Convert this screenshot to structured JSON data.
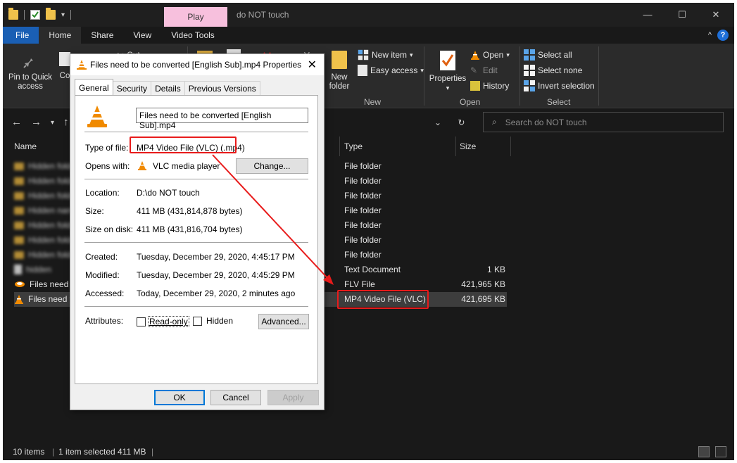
{
  "explorer": {
    "play_tab": "Play",
    "window_title": "do NOT touch",
    "window_controls": [
      "—",
      "☐",
      "✕"
    ],
    "tabs": [
      "File",
      "Home",
      "Share",
      "View",
      "Video Tools"
    ],
    "ribbon": {
      "pin": "Pin to Quick access",
      "copy_trunc": "Co",
      "cut_trunc": "Cut",
      "new_folder": "New folder",
      "new_item": "New item",
      "easy_access": "Easy access",
      "properties": "Properties",
      "open": "Open",
      "edit": "Edit",
      "history": "History",
      "select_all": "Select all",
      "select_none": "Select none",
      "invert_selection": "Invert selection",
      "group_new": "New",
      "group_open": "Open",
      "group_select": "Select"
    },
    "search_placeholder": "Search do NOT touch",
    "columns": {
      "name": "Name",
      "type": "Type",
      "size": "Size"
    },
    "rows": [
      {
        "name": "Hidden folder name",
        "type": "File folder",
        "size": ""
      },
      {
        "name": "Hidden folder name",
        "type": "File folder",
        "size": ""
      },
      {
        "name": "Hidden folder name",
        "type": "File folder",
        "size": ""
      },
      {
        "name": "Hidden name",
        "type": "File folder",
        "size": ""
      },
      {
        "name": "Hidden folder name",
        "type": "File folder",
        "size": ""
      },
      {
        "name": "Hidden folder name",
        "type": "File folder",
        "size": ""
      },
      {
        "name": "Hidden folder name",
        "type": "File folder",
        "size": ""
      },
      {
        "name": "hidden",
        "type": "Text Document",
        "size": "1 KB"
      },
      {
        "name": "Files need t",
        "type": "FLV File",
        "size": "421,965 KB"
      },
      {
        "name": "Files need t",
        "type": "MP4 Video File (VLC)",
        "size": "421,695 KB"
      }
    ],
    "status": {
      "items": "10 items",
      "selected": "1 item selected",
      "size": "411 MB"
    }
  },
  "dialog": {
    "title": "Files need to be converted [English Sub].mp4 Properties",
    "tabs": [
      "General",
      "Security",
      "Details",
      "Previous Versions"
    ],
    "filename": "Files need to be converted [English Sub].mp4",
    "type_label": "Type of file:",
    "type_value": "MP4 Video File (VLC) (.mp4)",
    "opens_label": "Opens with:",
    "opens_value": "VLC media player",
    "change_btn": "Change...",
    "location_label": "Location:",
    "location_value": "D:\\do NOT touch",
    "size_label": "Size:",
    "size_value": "411 MB (431,814,878 bytes)",
    "sizeondisk_label": "Size on disk:",
    "sizeondisk_value": "411 MB (431,816,704 bytes)",
    "created_label": "Created:",
    "created_value": "Tuesday, December 29, 2020, 4:45:17 PM",
    "modified_label": "Modified:",
    "modified_value": "Tuesday, December 29, 2020, 4:45:29 PM",
    "accessed_label": "Accessed:",
    "accessed_value": "Today, December 29, 2020, 2 minutes ago",
    "attributes_label": "Attributes:",
    "readonly": "Read-only",
    "hidden": "Hidden",
    "advanced_btn": "Advanced...",
    "ok": "OK",
    "cancel": "Cancel",
    "apply": "Apply"
  },
  "colors": {
    "highlight": "#e81b1b",
    "file_tab": "#1a5fb4",
    "play_tab": "#f7c0dd",
    "vlc_orange": "#f08a00"
  }
}
